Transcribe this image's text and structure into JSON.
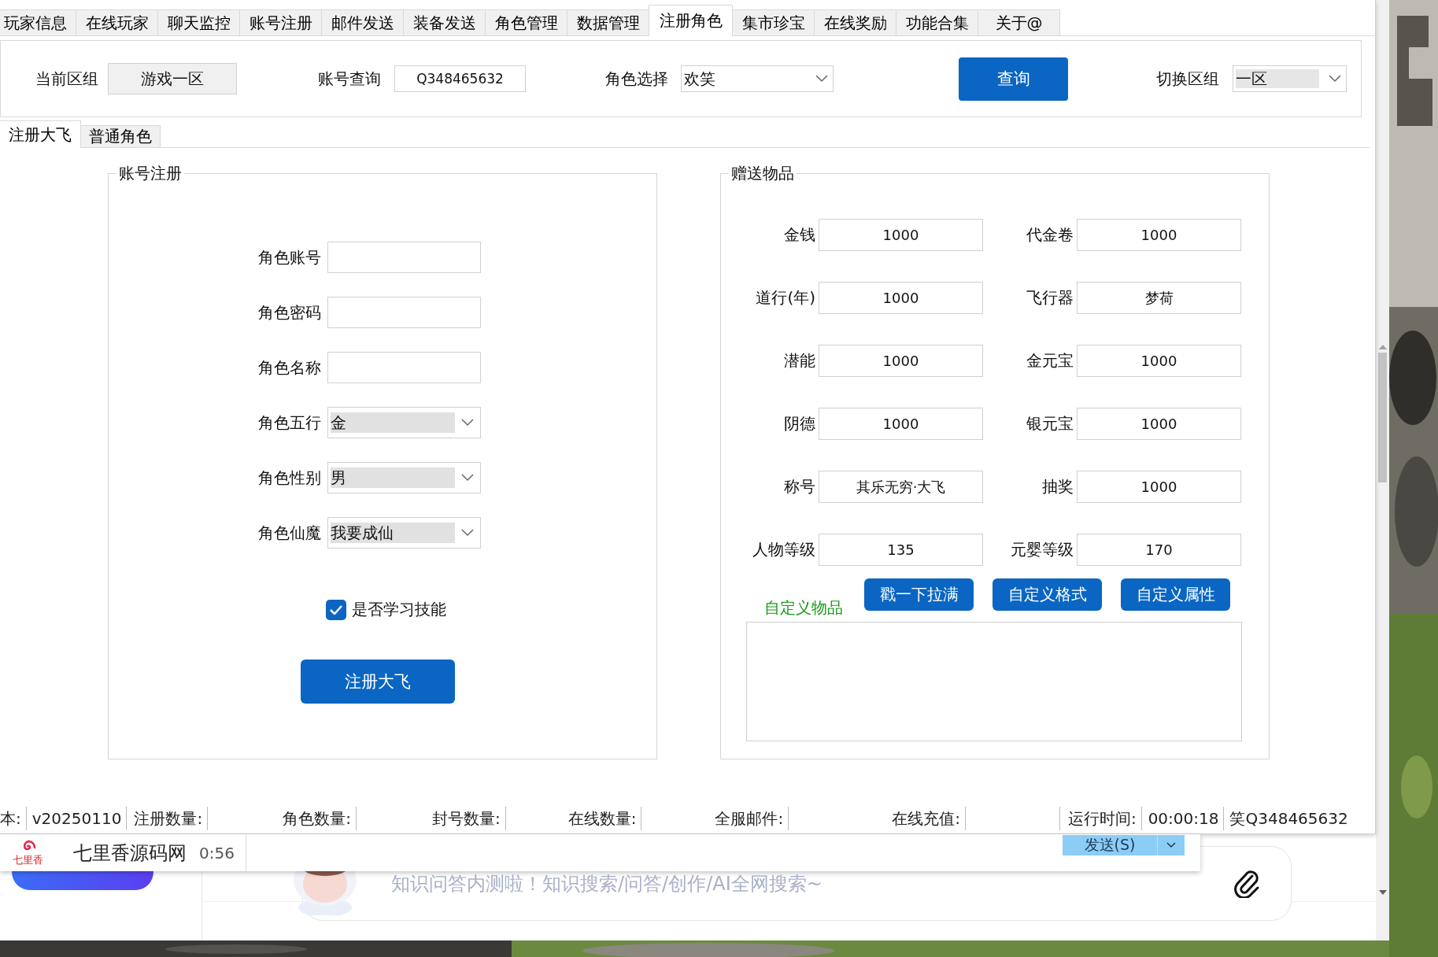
{
  "tabs": [
    {
      "label": "玩家信息",
      "selected": false
    },
    {
      "label": "在线玩家",
      "selected": false
    },
    {
      "label": "聊天监控",
      "selected": false
    },
    {
      "label": "账号注册",
      "selected": false
    },
    {
      "label": "邮件发送",
      "selected": false
    },
    {
      "label": "装备发送",
      "selected": false
    },
    {
      "label": "角色管理",
      "selected": false
    },
    {
      "label": "数据管理",
      "selected": false
    },
    {
      "label": "注册角色",
      "selected": true
    },
    {
      "label": "集市珍宝",
      "selected": false
    },
    {
      "label": "在线奖励",
      "selected": false
    },
    {
      "label": "功能合集",
      "selected": false
    },
    {
      "label": "关于@",
      "selected": false
    }
  ],
  "query_bar": {
    "zone_label": "当前区组",
    "zone_value": "游戏一区",
    "account_label": "账号查询",
    "account_value": "Q348465632",
    "role_label": "角色选择",
    "role_value": "欢笑",
    "query_button": "查询",
    "switch_label": "切换区组",
    "switch_value": "一区"
  },
  "subtabs": [
    {
      "label": "注册大飞",
      "selected": true
    },
    {
      "label": "普通角色",
      "selected": false
    }
  ],
  "register": {
    "title": "账号注册",
    "fields": [
      {
        "kind": "input",
        "label": "角色账号"
      },
      {
        "kind": "input",
        "label": "角色密码"
      },
      {
        "kind": "input",
        "label": "角色名称"
      },
      {
        "kind": "select",
        "label": "角色五行",
        "value": "金"
      },
      {
        "kind": "select",
        "label": "角色性别",
        "value": "男"
      },
      {
        "kind": "select",
        "label": "角色仙魔",
        "value": "我要成仙"
      }
    ],
    "learn_skills": {
      "label": "是否学习技能",
      "checked": true
    },
    "submit_button": "注册大飞"
  },
  "gifts": {
    "title": "赠送物品",
    "fields": [
      {
        "label": "金钱",
        "value": "1000"
      },
      {
        "label": "代金卷",
        "value": "1000"
      },
      {
        "label": "道行(年)",
        "value": "1000"
      },
      {
        "label": "飞行器",
        "value": "梦荷"
      },
      {
        "label": "潜能",
        "value": "1000"
      },
      {
        "label": "金元宝",
        "value": "1000"
      },
      {
        "label": "阴德",
        "value": "1000"
      },
      {
        "label": "银元宝",
        "value": "1000"
      },
      {
        "label": "称号",
        "value": "其乐无穷·大飞"
      },
      {
        "label": "抽奖",
        "value": "1000"
      },
      {
        "label": "人物等级",
        "value": "135"
      },
      {
        "label": "元婴等级",
        "value": "170"
      }
    ],
    "custom_label": "自定义物品",
    "buttons": [
      "戳一下拉满",
      "自定义格式",
      "自定义属性"
    ]
  },
  "status_bar": {
    "items": [
      "本:",
      "v20250110",
      "注册数量:",
      "角色数量:",
      "封号数量:",
      "在线数量:",
      "全服邮件:",
      "在线充值:",
      "运行时间:",
      "00:00:18",
      "笑Q348465632"
    ]
  },
  "popup": {
    "logo_text": "七里香",
    "title": "七里香源码网",
    "time": "0:56"
  },
  "chat": {
    "send_button": "发送(S)",
    "input": {
      "placeholder": "知识问答内测啦！知识搜索/问答/创作/AI全网搜索~"
    }
  }
}
